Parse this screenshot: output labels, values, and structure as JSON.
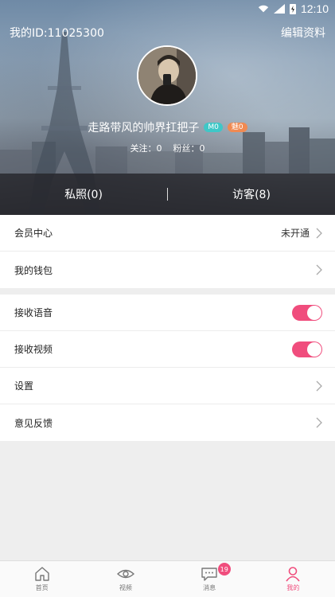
{
  "status_bar": {
    "time": "12:10"
  },
  "header": {
    "user_id_label": "我的ID:11025300",
    "edit_profile": "编辑资料",
    "nickname": "走路带风的帅界扛把子",
    "level_badge": "M0",
    "charm_badge": "魅0",
    "following": "关注：0",
    "fans": "粉丝：0"
  },
  "tabs": [
    {
      "label": "私照(0)"
    },
    {
      "label": "访客(8)"
    }
  ],
  "menu_group_1": [
    {
      "label": "会员中心",
      "value": "未开通"
    },
    {
      "label": "我的钱包"
    }
  ],
  "menu_group_2": [
    {
      "label": "接收语音",
      "toggle": "on"
    },
    {
      "label": "接收视频",
      "toggle": "on"
    },
    {
      "label": "设置"
    },
    {
      "label": "意见反馈"
    }
  ],
  "bottom_nav": [
    {
      "label": "首页",
      "icon": "home-icon"
    },
    {
      "label": "视频",
      "icon": "eye-icon"
    },
    {
      "label": "消息",
      "icon": "message-icon",
      "badge": "19"
    },
    {
      "label": "我的",
      "icon": "user-icon",
      "active": true
    }
  ],
  "colors": {
    "accent": "#f04d7d",
    "level_badge": "#3fc7c7",
    "charm_badge": "#f08a52"
  }
}
